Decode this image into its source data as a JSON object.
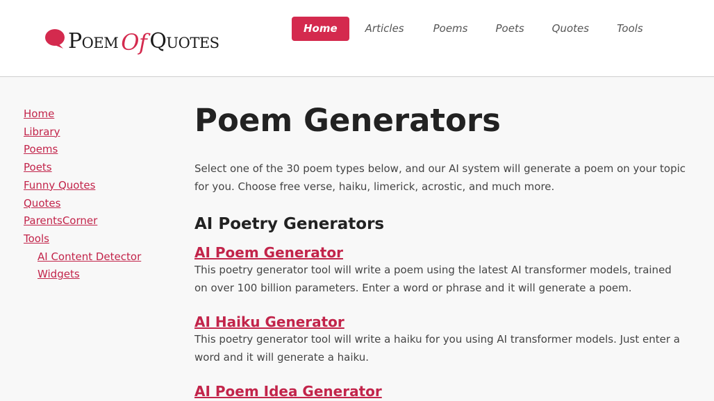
{
  "header": {
    "logo": {
      "text_before": "Poem",
      "text_of": "Of",
      "text_after": "Quotes"
    },
    "nav": [
      {
        "label": "Home",
        "active": true
      },
      {
        "label": "Articles",
        "active": false
      },
      {
        "label": "Poems",
        "active": false
      },
      {
        "label": "Poets",
        "active": false
      },
      {
        "label": "Quotes",
        "active": false
      },
      {
        "label": "Tools",
        "active": false
      }
    ]
  },
  "sidebar": {
    "items": [
      {
        "label": "Home"
      },
      {
        "label": "Library"
      },
      {
        "label": "Poems"
      },
      {
        "label": "Poets"
      },
      {
        "label": "Funny Quotes"
      },
      {
        "label": "Quotes"
      },
      {
        "label": "ParentsCorner"
      },
      {
        "label": "Tools"
      }
    ],
    "subitems": [
      {
        "label": "AI Content Detector"
      },
      {
        "label": "Widgets"
      }
    ]
  },
  "main": {
    "title": "Poem Generators",
    "intro": "Select one of the 30 poem types below, and our AI system will generate a poem on your topic for you. Choose free verse, haiku, limerick, acrostic, and much more.",
    "section_title": "AI Poetry Generators",
    "generators": [
      {
        "title": "AI Poem Generator",
        "description": "This poetry generator tool will write a poem using the latest AI transformer models, trained on over 100 billion parameters. Enter a word or phrase and it will generate a poem."
      },
      {
        "title": "AI Haiku Generator",
        "description": "This poetry generator tool will write a haiku for you using AI transformer models. Just enter a word and it will generate a haiku."
      },
      {
        "title": "AI Poem Idea Generator",
        "description": ""
      }
    ]
  },
  "colors": {
    "accent": "#d42a4e",
    "link": "#c2244a",
    "background": "#f8f8f8",
    "header_bg": "#ffffff"
  }
}
